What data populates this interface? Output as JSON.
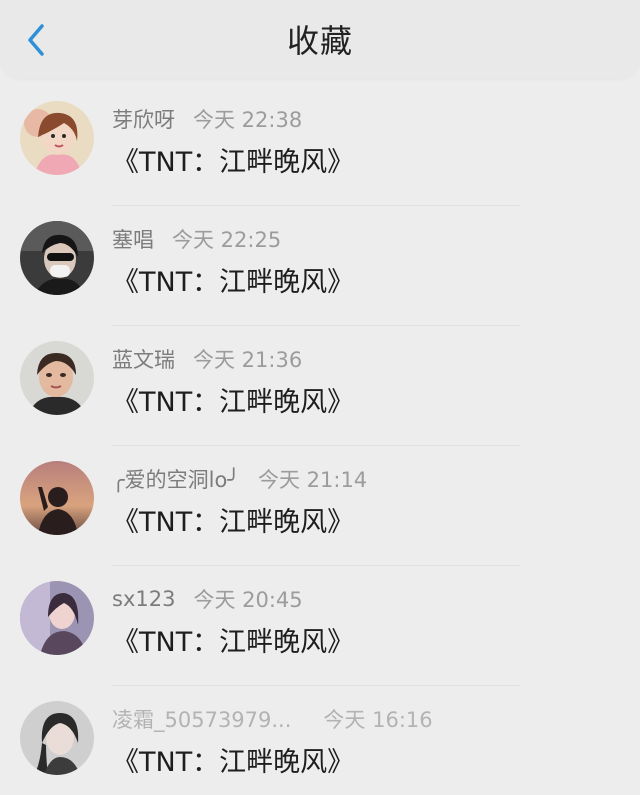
{
  "header": {
    "title": "收藏",
    "back_icon": "chevron-left-icon",
    "accent": "#2f8fd8"
  },
  "items": [
    {
      "name": "芽欣呀",
      "time": "今天 22:38",
      "content": "《TNT：江畔晚风》",
      "avatar_icon": "user-avatar-illustration"
    },
    {
      "name": "塞唱",
      "time": "今天 22:25",
      "content": "《TNT：江畔晚风》",
      "avatar_icon": "user-avatar-photo"
    },
    {
      "name": "蓝文瑞",
      "time": "今天 21:36",
      "content": "《TNT：江畔晚风》",
      "avatar_icon": "user-avatar-photo"
    },
    {
      "name": "╭爱的空洞lo╯",
      "time": "今天 21:14",
      "content": "《TNT：江畔晚风》",
      "avatar_icon": "user-avatar-silhouette"
    },
    {
      "name": "sx123",
      "time": "今天 20:45",
      "content": "《TNT：江畔晚风》",
      "avatar_icon": "user-avatar-photo"
    },
    {
      "name": "凌霜_50573979...",
      "time": "今天 16:16",
      "content": "《TNT：江畔晚风》",
      "avatar_icon": "user-avatar-photo"
    }
  ]
}
